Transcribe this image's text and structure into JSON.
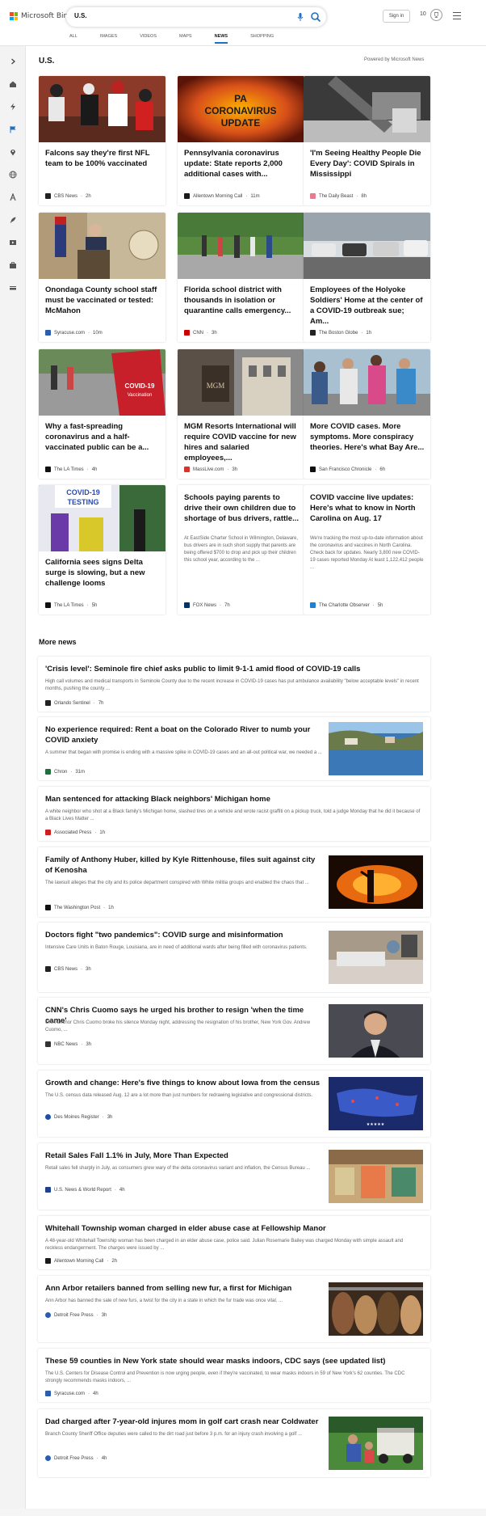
{
  "header": {
    "brand": "Microsoft Bing",
    "search_value": "U.S.",
    "signin_label": "Sign in",
    "rewards_count": "10",
    "tabs": [
      {
        "label": "ALL"
      },
      {
        "label": "IMAGES"
      },
      {
        "label": "VIDEOS"
      },
      {
        "label": "MAPS"
      },
      {
        "label": "NEWS"
      },
      {
        "label": "SHOPPING"
      }
    ],
    "active_tab": "NEWS"
  },
  "main": {
    "section_title": "U.S.",
    "powered_by": "Powered by Microsoft News",
    "cards": [
      {
        "title": "Falcons say they're first NFL team to be 100% vaccinated",
        "source": "CBS News",
        "time": "2h",
        "icon": "cbs-icon",
        "color": "#222222"
      },
      {
        "title": "Pennsylvania coronavirus update: State reports 2,000 additional cases with...",
        "source": "Allentown Morning Call",
        "time": "11m",
        "icon": "mcall-icon",
        "color": "#1a1a1a"
      },
      {
        "title": "'I'm Seeing Healthy People Die Every Day': COVID Spirals in Mississippi",
        "source": "The Daily Beast",
        "time": "8h",
        "icon": "daily-beast-icon",
        "color": "#e87a8f"
      },
      {
        "title": "Onondaga County school staff must be vaccinated or tested: McMahon",
        "source": "Syracuse.com",
        "time": "10m",
        "icon": "syracuse-icon",
        "color": "#2a5db0"
      },
      {
        "title": "Florida school district with thousands in isolation or quarantine calls emergency...",
        "source": "CNN",
        "time": "3h",
        "icon": "cnn-icon",
        "color": "#cc0000"
      },
      {
        "title": "Employees of the Holyoke Soldiers' Home at the center of a COVID-19 outbreak sue; Am...",
        "source": "The Boston Globe",
        "time": "1h",
        "icon": "boston-globe-icon",
        "color": "#222222"
      },
      {
        "title": "Why a fast-spreading coronavirus and a half-vaccinated public can be a...",
        "source": "The LA Times",
        "time": "4h",
        "icon": "latimes-icon",
        "color": "#111111"
      },
      {
        "title": "MGM Resorts International will require COVID vaccine for new hires and salaried employees,...",
        "source": "MassLive.com",
        "time": "3h",
        "icon": "masslive-icon",
        "color": "#d9342b"
      },
      {
        "title": "More COVID cases. More symptoms. More conspiracy theories. Here's what Bay Are...",
        "source": "San Francisco Chronicle",
        "time": "6h",
        "icon": "sfchronicle-icon",
        "color": "#111111"
      },
      {
        "title": "California sees signs Delta surge is slowing, but a new challenge looms",
        "source": "The LA Times",
        "time": "5h",
        "icon": "latimes-icon",
        "color": "#111111"
      },
      {
        "title": "Schools paying parents to drive their own children due to shortage of bus drivers, rattle...",
        "snippet": "At EastSide Charter School in Wilmington, Delaware, bus drivers are in such short supply that parents are being offered $700 to drop and pick up their children this school year, according to the ...",
        "source": "FOX News",
        "time": "7h",
        "icon": "fox-icon",
        "color": "#003366"
      },
      {
        "title": "COVID vaccine live updates: Here's what to know in North Carolina on Aug. 17",
        "snippet": "We're tracking the most up-to-date information about the coronavirus and vaccines in North Carolina. Check back for updates. Nearly 3,800 new COVID-19 cases reported Monday At least 1,122,412 people ...",
        "source": "The Charlotte Observer",
        "time": "5h",
        "icon": "charlotte-icon",
        "color": "#1f7fd1"
      }
    ],
    "more_news_title": "More news",
    "more_news": [
      {
        "title": "'Crisis level': Seminole fire chief asks public to limit 9-1-1 amid flood of COVID-19 calls",
        "snippet": "High call volumes and medical transports in Seminole County due to the recent increase in COVID-19 cases has put ambulance availability \"below acceptable levels\" in recent months, pushing the county ...",
        "source": "Orlando Sentinel",
        "time": "7h",
        "icon": "orlando-sentinel-icon",
        "color": "#222222"
      },
      {
        "title": "No experience required: Rent a boat on the Colorado River to numb your COVID anxiety",
        "snippet": "A summer that began with promise is ending with a massive spike in COVID-19 cases and an all-out political war, we needed a ...",
        "source": "Chron",
        "time": "31m",
        "icon": "chron-icon",
        "color": "#1f6f3f"
      },
      {
        "title": "Man sentenced for attacking Black neighbors' Michigan home",
        "snippet": "A white neighbor who shot at a Black family's Michigan home, slashed tires on a vehicle and wrote racist graffiti on a pickup truck, told a judge Monday that he did it because of a Black Lives Matter ...",
        "source": "Associated Press",
        "time": "1h",
        "icon": "ap-icon",
        "color": "#cc1f1f"
      },
      {
        "title": "Family of Anthony Huber, killed by Kyle Rittenhouse, files suit against city of Kenosha",
        "snippet": "The lawsuit alleges that the city and its police department conspired with White militia groups and enabled the chaos that ...",
        "source": "The Washington Post",
        "time": "1h",
        "icon": "wapo-icon",
        "color": "#111111"
      },
      {
        "title": "Doctors fight \"two pandemics\": COVID surge and misinformation",
        "snippet": "Intensive Care Units in Baton Rouge, Louisiana, are in need of additional wards after being filled with coronavirus patients.",
        "source": "CBS News",
        "time": "3h",
        "icon": "cbs-icon",
        "color": "#222222"
      },
      {
        "title": "CNN's Chris Cuomo says he urged his brother to resign 'when the time came'",
        "snippet": "CNN anchor Chris Cuomo broke his silence Monday night, addressing the resignation of his brother, New York Gov. Andrew Cuomo, ...",
        "source": "NBC News",
        "time": "3h",
        "icon": "nbc-icon",
        "color": "#333333"
      },
      {
        "title": "Growth and change: Here's five things to know about Iowa from the census",
        "snippet": "The U.S. census data released Aug. 12 are a lot more than just numbers for redrawing legislative and congressional districts.",
        "source": "Des Moines Register",
        "time": "3h",
        "icon": "des-moines-register-icon",
        "color": "#1f4fa5"
      },
      {
        "title": "Retail Sales Fall 1.1% in July, More Than Expected",
        "snippet": "Retail sales fell sharply in July, as consumers grew wary of the delta coronavirus variant and inflation, the Census Bureau ...",
        "source": "U.S. News & World Report",
        "time": "4h",
        "icon": "usnews-icon",
        "color": "#1f3f8f"
      },
      {
        "title": "Whitehall Township woman charged in elder abuse case at Fellowship Manor",
        "snippet": "A 48-year-old Whitehall Township woman has been charged in an elder abuse case, police said. Julian Rosemarie Bailey was charged Monday with simple assault and reckless endangerment. The charges were issued by ...",
        "source": "Allentown Morning Call",
        "time": "2h",
        "icon": "mcall-icon",
        "color": "#1a1a1a"
      },
      {
        "title": "Ann Arbor retailers banned from selling new fur, a first for Michigan",
        "snippet": "Ann Arbor has banned the sale of new furs, a twist for the city in a state in which the fur trade was once vital. ...",
        "source": "Detroit Free Press",
        "time": "3h",
        "icon": "freep-icon",
        "color": "#2a5db0"
      },
      {
        "title": "These 59 counties in New York state should wear masks indoors, CDC says (see updated list)",
        "snippet": "The U.S. Centers for Disease Control and Prevention is now urging people, even if they're vaccinated, to wear masks indoors in 59 of New York's 62 counties. The CDC strongly recommends masks indoors, ...",
        "source": "Syracuse.com",
        "time": "4h",
        "icon": "syracuse-icon",
        "color": "#2a5db0"
      },
      {
        "title": "Dad charged after 7-year-old injures mom in golf cart crash near Coldwater",
        "snippet": "Branch County Sheriff Office deputies were called to the dirt road just before 3 p.m. for an injury crash involving a golf ...",
        "source": "Detroit Free Press",
        "time": "4h",
        "icon": "freep-icon",
        "color": "#2a5db0"
      }
    ]
  },
  "colors": {
    "accent": "#1f6fc5",
    "rail_bg": "#f3f3f3"
  }
}
